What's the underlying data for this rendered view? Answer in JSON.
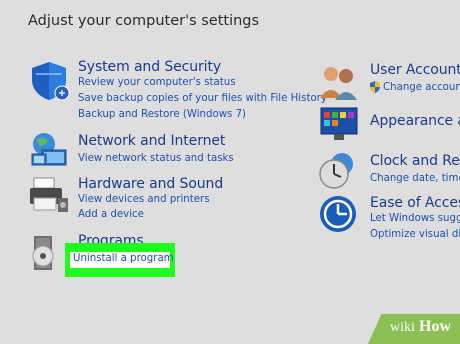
{
  "heading": "Adjust your computer's settings",
  "left": [
    {
      "title": "System and Security",
      "links": [
        "Review your computer's status",
        "Save backup copies of your files with File History",
        "Backup and Restore (Windows 7)"
      ]
    },
    {
      "title": "Network and Internet",
      "links": [
        "View network status and tasks"
      ]
    },
    {
      "title": "Hardware and Sound",
      "links": [
        "View devices and printers",
        "Add a device"
      ]
    },
    {
      "title": "Programs",
      "links": [
        "Uninstall a program"
      ]
    }
  ],
  "right": [
    {
      "title": "User Accounts",
      "links": [
        "Change account t"
      ]
    },
    {
      "title": "Appearance and",
      "links": []
    },
    {
      "title": "Clock and Regi",
      "links": [
        "Change date, time, c"
      ]
    },
    {
      "title": "Ease of Access",
      "links": [
        "Let Windows sugges",
        "Optimize visual displ"
      ]
    }
  ],
  "watermark": {
    "wiki": "wiki",
    "how": "How"
  },
  "colors": {
    "highlight": "#1fff1f",
    "link": "#1d4fb0",
    "title": "#1a3a8a"
  }
}
